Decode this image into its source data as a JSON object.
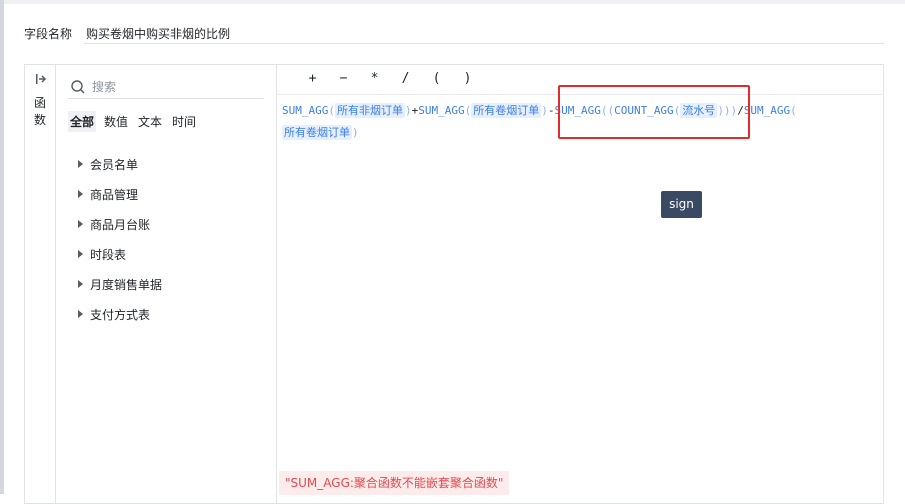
{
  "field": {
    "label": "字段名称",
    "value": "购买卷烟中购买非烟的比例"
  },
  "side_tab": {
    "label": "函数",
    "icon": "collapse-arrow-icon"
  },
  "search": {
    "placeholder": "搜索"
  },
  "category_tabs": [
    {
      "label": "全部",
      "active": true
    },
    {
      "label": "数值",
      "active": false
    },
    {
      "label": "文本",
      "active": false
    },
    {
      "label": "时间",
      "active": false
    }
  ],
  "tree_items": [
    {
      "label": "会员名单"
    },
    {
      "label": "商品管理"
    },
    {
      "label": "商品月台账"
    },
    {
      "label": "时段表"
    },
    {
      "label": "月度销售单据"
    },
    {
      "label": "支付方式表"
    }
  ],
  "operators": [
    "+",
    "−",
    "*",
    "/",
    "(",
    ")"
  ],
  "formula": {
    "t1": "SUM_AGG",
    "p1": "(",
    "f1": "所有非烟订单",
    "p2": ")",
    "op1": "+",
    "t2": "SUM_AGG",
    "p3": "(",
    "f2": "所有卷烟订单",
    "p4": ")",
    "op2": "-",
    "t3": "SUM_AGG",
    "p5": "((",
    "t4": "COUNT_AGG",
    "p6": "(",
    "f3": "流水号",
    "p7": ")))",
    "op3": "/",
    "t5": "SUM_AGG",
    "p8": "(",
    "f4": "所有卷烟订单",
    "p9": ")"
  },
  "tooltip": {
    "text": "sign"
  },
  "error": {
    "text": "\"SUM_AGG:聚合函数不能嵌套聚合函数\""
  },
  "colors": {
    "function_blue": "#3d7fe8",
    "highlight_red": "#e32b2b",
    "error_red": "#e5484d",
    "tooltip_bg": "#3a4a63"
  }
}
